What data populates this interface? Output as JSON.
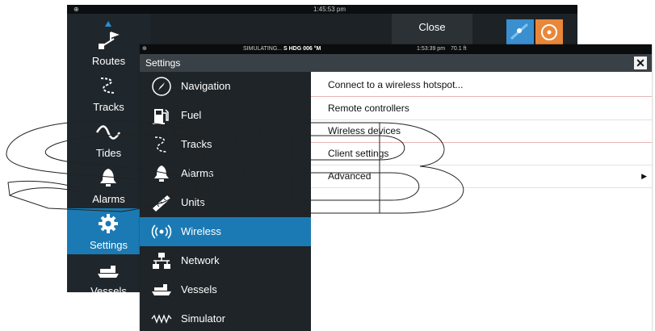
{
  "background_window": {
    "status_time": "1:45:53 pm",
    "close_label": "Close",
    "sidebar": [
      {
        "label": "",
        "icon": "waypoint-icon"
      },
      {
        "label": "Routes",
        "icon": "routes-icon"
      },
      {
        "label": "Tracks",
        "icon": "tracks-icon"
      },
      {
        "label": "Tides",
        "icon": "tides-icon"
      },
      {
        "label": "Alarms",
        "icon": "bell-icon"
      },
      {
        "label": "Settings",
        "icon": "gear-icon"
      },
      {
        "label": "Vessels",
        "icon": "vessels-icon"
      }
    ],
    "selected_index": 5,
    "accent": "#1b7ab4"
  },
  "front_window": {
    "status": {
      "simulating": "SIMULATING...",
      "heading": "S HDG 006 °M",
      "time": "1:53:39 pm",
      "depth": "70.1 ft"
    },
    "title": "Settings",
    "close_icon": "close-icon",
    "menu": [
      {
        "label": "Navigation",
        "icon": "compass-icon"
      },
      {
        "label": "Fuel",
        "icon": "fuel-pump-icon"
      },
      {
        "label": "Tracks",
        "icon": "tracks-icon"
      },
      {
        "label": "Alarms",
        "icon": "bell-icon"
      },
      {
        "label": "Units",
        "icon": "ruler-icon"
      },
      {
        "label": "Wireless",
        "icon": "wireless-icon"
      },
      {
        "label": "Network",
        "icon": "network-icon"
      },
      {
        "label": "Vessels",
        "icon": "vessels-icon"
      },
      {
        "label": "Simulator",
        "icon": "simulator-icon"
      }
    ],
    "selected_index": 5,
    "content_rows": [
      {
        "label": "Connect to a wireless hotspot...",
        "has_submenu": false
      },
      {
        "label": "Remote controllers",
        "has_submenu": false
      },
      {
        "label": "Wireless devices",
        "has_submenu": false
      },
      {
        "label": "Client settings",
        "has_submenu": false
      },
      {
        "label": "Advanced",
        "has_submenu": true
      }
    ],
    "colors": {
      "selected": "#1b7ab4",
      "sidebar": "#1e2428",
      "titlebar": "#3a4146"
    }
  }
}
